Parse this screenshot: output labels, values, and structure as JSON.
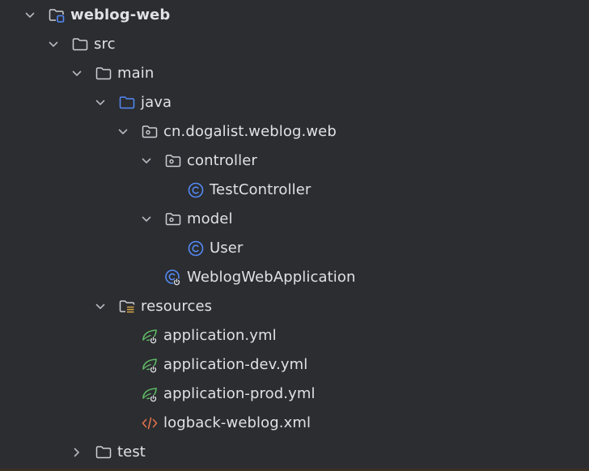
{
  "tree": {
    "root": {
      "label": "weblog-web"
    },
    "src": {
      "label": "src"
    },
    "main": {
      "label": "main"
    },
    "java": {
      "label": "java"
    },
    "package": {
      "label": "cn.dogalist.weblog.web"
    },
    "controller": {
      "label": "controller"
    },
    "test_controller": {
      "label": "TestController"
    },
    "model": {
      "label": "model"
    },
    "user": {
      "label": "User"
    },
    "app_class": {
      "label": "WeblogWebApplication"
    },
    "resources": {
      "label": "resources"
    },
    "app_yml": {
      "label": "application.yml"
    },
    "app_dev_yml": {
      "label": "application-dev.yml"
    },
    "app_prod_yml": {
      "label": "application-prod.yml"
    },
    "logback": {
      "label": "logback-weblog.xml"
    },
    "test": {
      "label": "test"
    }
  },
  "colors": {
    "background": "#2b2d30",
    "text": "#dfe1e5",
    "chevron": "#b4b8bf",
    "folder": "#ced0d6",
    "source_folder": "#548af7",
    "class_icon": "#548af7",
    "spring": "#5fb865",
    "xml": "#e0724a",
    "resources_lines": "#d7a84a"
  },
  "icons": {
    "expanded": "chevron-down-icon",
    "collapsed": "chevron-right-icon",
    "module": "module-folder-icon",
    "folder": "folder-icon",
    "source_root": "source-root-folder-icon",
    "package": "package-icon",
    "class": "class-icon",
    "spring_boot_class": "spring-boot-class-icon",
    "resources_root": "resources-root-icon",
    "spring_config": "spring-config-icon",
    "xml_file": "xml-file-icon"
  }
}
